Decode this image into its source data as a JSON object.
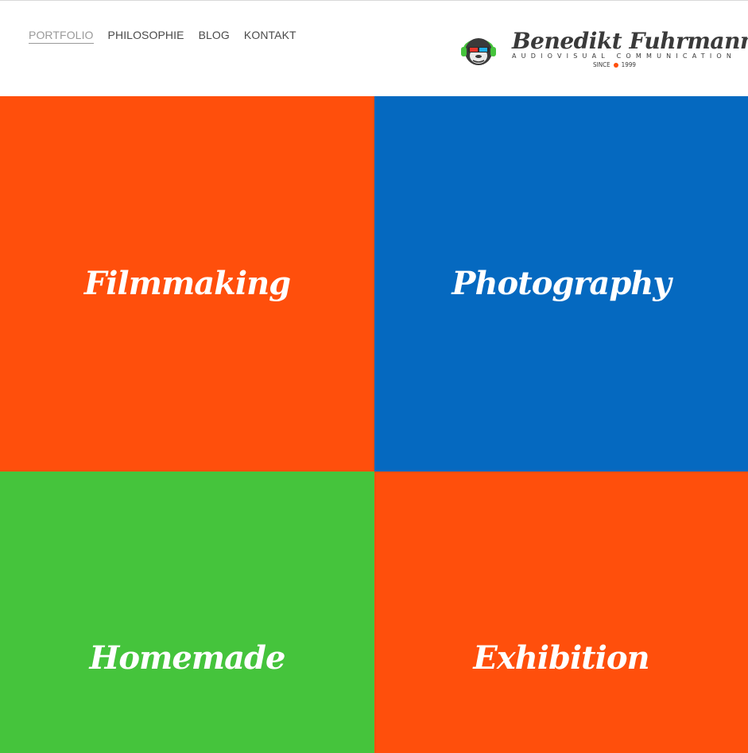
{
  "nav": {
    "items": [
      {
        "label": "PORTFOLIO",
        "active": true
      },
      {
        "label": "PHILOSOPHIE",
        "active": false
      },
      {
        "label": "BLOG",
        "active": false
      },
      {
        "label": "KONTAKT",
        "active": false
      }
    ]
  },
  "logo": {
    "name": "Benedikt Fuhrmann",
    "tagline": "AUDIOVISUAL COMMUNICATION",
    "since_prefix": "SINCE",
    "since_year": "1999",
    "icon": "gorilla-with-headphones-and-3d-glasses-icon"
  },
  "tiles": [
    {
      "label": "Filmmaking",
      "color": "#ff4f0c"
    },
    {
      "label": "Photography",
      "color": "#0569c0"
    },
    {
      "label": "Homemade",
      "color": "#45c43c"
    },
    {
      "label": "Exhibition",
      "color": "#ff4f0c"
    }
  ],
  "colors": {
    "accent_orange": "#ff4f0c",
    "accent_blue": "#0569c0",
    "accent_green": "#45c43c",
    "text_dark": "#3a3a3a",
    "nav_active": "#9a9a9a"
  }
}
